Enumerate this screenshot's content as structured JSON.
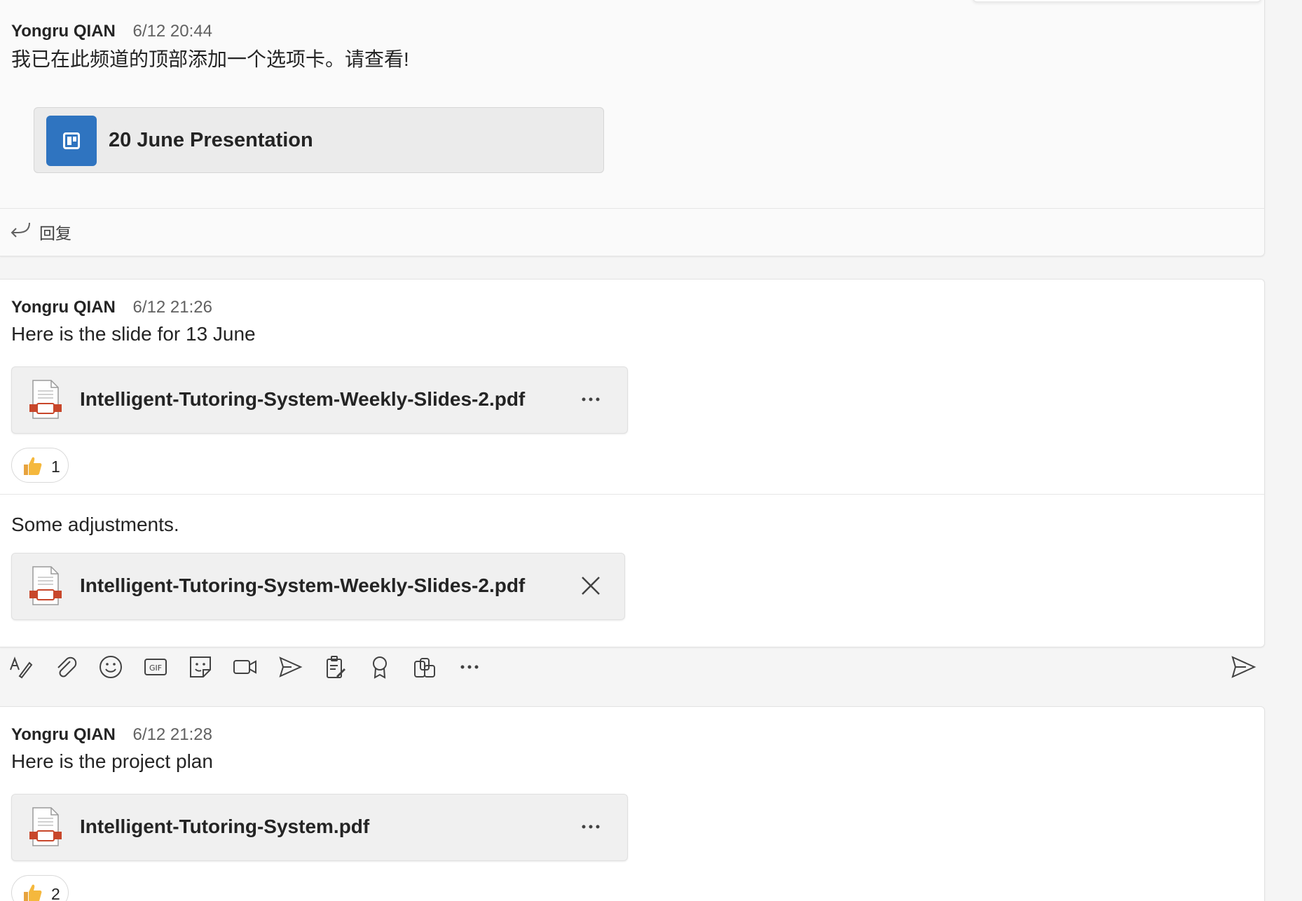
{
  "messages": [
    {
      "author": "Yongru QIAN",
      "time": "6/12 20:44",
      "text": "我已在此频道的顶部添加一个选项卡。请查看!",
      "tab_card": {
        "title": "20 June Presentation",
        "icon": "planner-board-icon"
      },
      "reply_label": "回复"
    },
    {
      "author": "Yongru QIAN",
      "time": "6/12 21:26",
      "text": "Here is the slide for 13 June",
      "file": {
        "name": "Intelligent-Tutoring-System-Weekly-Slides-2.pdf",
        "action_icon": "more-options-icon"
      },
      "reaction": {
        "icon": "thumbs-up-icon",
        "count": "1"
      }
    }
  ],
  "draft": {
    "text": "Some adjustments.",
    "file": {
      "name": "Intelligent-Tutoring-System-Weekly-Slides-2.pdf",
      "action_icon": "close-icon"
    }
  },
  "compose_toolbar": {
    "tools": [
      "format-icon",
      "attach-icon",
      "emoji-icon",
      "gif-icon",
      "sticker-icon",
      "meet-now-icon",
      "schedule-send-icon",
      "loop-icon",
      "praise-icon",
      "apps-icon",
      "more-options-icon"
    ],
    "send_icon": "send-icon"
  },
  "messages_after": [
    {
      "author": "Yongru QIAN",
      "time": "6/12 21:28",
      "text": "Here is the project plan",
      "file": {
        "name": "Intelligent-Tutoring-System.pdf",
        "action_icon": "more-options-icon"
      },
      "reaction": {
        "icon": "thumbs-up-icon",
        "count": "2"
      }
    }
  ],
  "colors": {
    "accent": "#2f74c0",
    "pdf_red": "#c8472b",
    "page_bg": "#f5f5f5"
  }
}
